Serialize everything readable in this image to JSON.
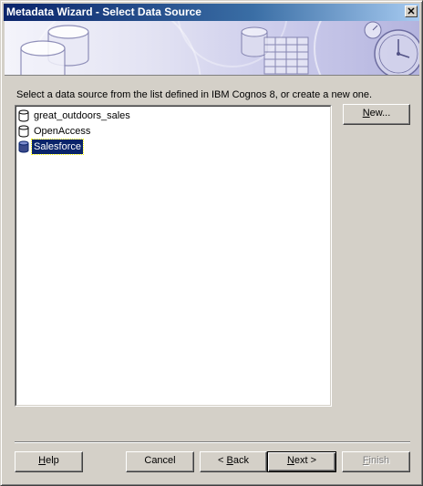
{
  "window": {
    "title": "Metadata Wizard - Select Data Source",
    "close_glyph": "✕"
  },
  "instruction": "Select a data source from the list defined in IBM Cognos 8, or create a new one.",
  "data_sources": [
    {
      "label": "great_outdoors_sales",
      "icon": "database-icon",
      "selected": false
    },
    {
      "label": "OpenAccess",
      "icon": "database-icon",
      "selected": false
    },
    {
      "label": "Salesforce",
      "icon": "database-icon",
      "selected": true
    }
  ],
  "buttons": {
    "new": {
      "label": "New...",
      "mnemonic": "N",
      "rest": "ew..."
    },
    "help": {
      "label": "Help",
      "mnemonic": "H",
      "rest": "elp"
    },
    "cancel": {
      "label": "Cancel"
    },
    "back": {
      "label": "< Back",
      "prefix": "< ",
      "mnemonic": "B",
      "rest": "ack"
    },
    "next": {
      "label": "Next >",
      "mnemonic": "N",
      "rest": "ext >"
    },
    "finish": {
      "label": "Finish",
      "mnemonic": "F",
      "rest": "inish",
      "disabled": true
    }
  },
  "colors": {
    "title_gradient_start": "#0a246a",
    "title_gradient_end": "#a6caf0",
    "selection": "#0a246a",
    "dialog_face": "#d4d0c8"
  }
}
